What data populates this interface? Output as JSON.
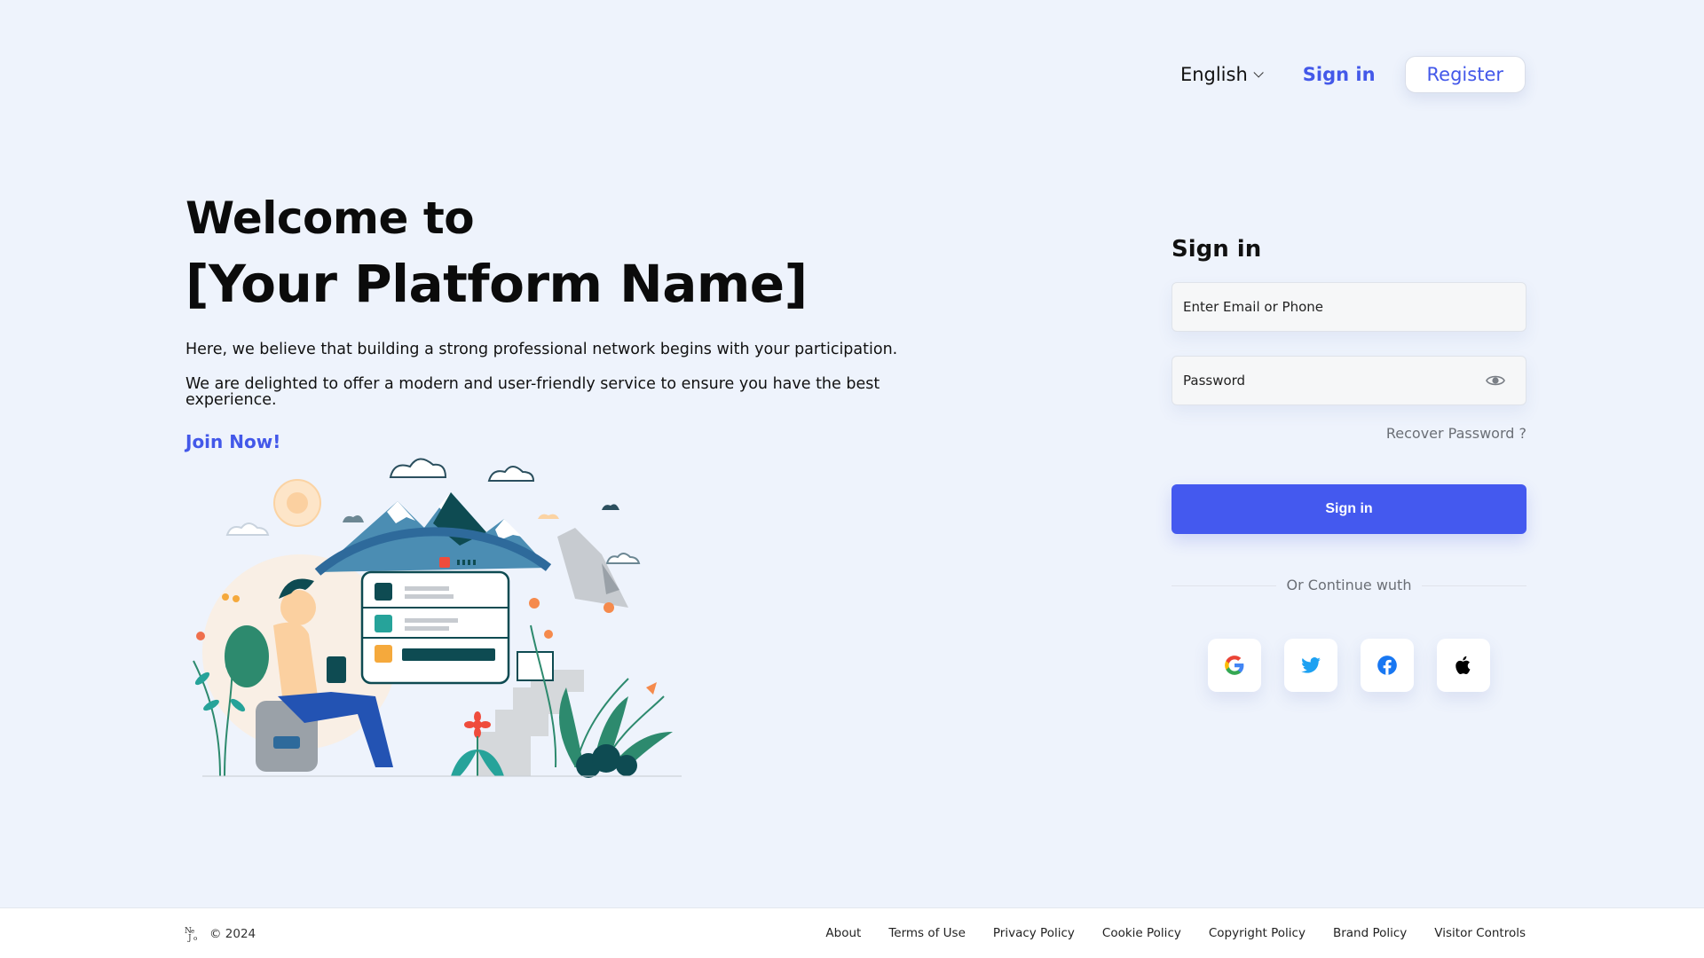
{
  "header": {
    "language": "English",
    "signin_label": "Sign in",
    "register_label": "Register"
  },
  "hero": {
    "title_line1": "Welcome to",
    "title_line2": "[Your Platform Name]",
    "description1": "Here, we believe that building a strong professional network begins with your participation.",
    "description2": "We are delighted to offer a modern and user-friendly service to ensure you have the best experience.",
    "join_label": "Join Now!"
  },
  "signin": {
    "title": "Sign in",
    "email_placeholder": "Enter Email or Phone",
    "password_placeholder": "Password",
    "recover_label": "Recover Password ?",
    "submit_label": "Sign in",
    "divider_text": "Or Continue wuth",
    "social_buttons": [
      {
        "icon": "google-icon"
      },
      {
        "icon": "twitter-icon"
      },
      {
        "icon": "facebook-icon"
      },
      {
        "icon": "apple-icon"
      }
    ]
  },
  "footer": {
    "copyright": "© 2024",
    "links": [
      "About",
      "Terms of Use",
      "Privacy Policy",
      "Cookie Policy",
      "Copyright Policy",
      "Brand Policy",
      "Visitor Controls"
    ]
  },
  "colors": {
    "background": "#eef3fc",
    "accent": "#4358e9",
    "button": "#4459ef"
  }
}
